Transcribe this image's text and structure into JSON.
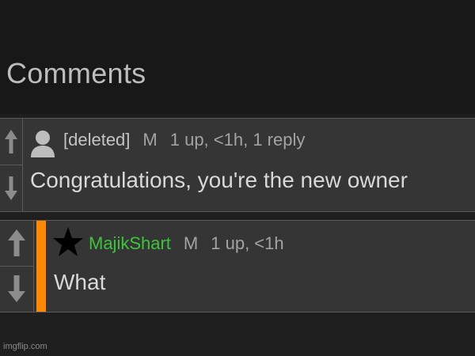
{
  "section": {
    "title": "Comments"
  },
  "comments": [
    {
      "author": "[deleted]",
      "mod_flag": "M",
      "stats": "1 up, <1h, 1 reply",
      "text": "Congratulations, you're the new owner",
      "avatar_icon": "person-icon"
    },
    {
      "author": "MajikShart",
      "mod_flag": "M",
      "stats": "1 up, <1h",
      "text": "What",
      "avatar_icon": "star-icon",
      "author_color": "#3cc53c",
      "reply_bar_color": "#ff8800"
    }
  ],
  "watermark": "imgflip.com"
}
